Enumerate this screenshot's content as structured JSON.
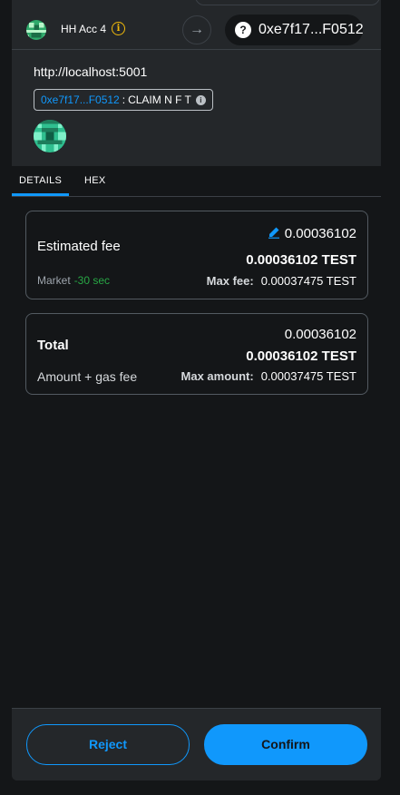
{
  "header": {
    "account_name": "HH Acc 4",
    "info_glyph": "i",
    "arrow_glyph": "→",
    "recipient_glyph": "?",
    "recipient_address": "0xe7f17...F0512"
  },
  "site": {
    "origin": "http://localhost:5001",
    "method_address": "0xe7f17...F0512",
    "method_separator": ":",
    "method_name": "CLAIM N F T",
    "method_info_glyph": "i"
  },
  "tabs": [
    "DETAILS",
    "HEX"
  ],
  "active_tab": "DETAILS",
  "fee_card": {
    "label": "Estimated fee",
    "primary_value": "0.00036102",
    "secondary_value": "0.00036102 TEST",
    "market_label": "Market",
    "market_time": "-30 sec",
    "max_fee_label": "Max fee:",
    "max_fee_value": "0.00037475 TEST"
  },
  "total_card": {
    "label": "Total",
    "primary_value": "0.00036102",
    "secondary_value": "0.00036102 TEST",
    "sub_label": "Amount + gas fee",
    "max_amount_label": "Max amount:",
    "max_amount_value": "0.00037475 TEST"
  },
  "footer": {
    "reject_label": "Reject",
    "confirm_label": "Confirm"
  },
  "colors": {
    "accent": "#1098fc",
    "market_time": "#28a745",
    "warning": "#f0b90b",
    "background": "#141618",
    "panel": "#24272a"
  },
  "icons": {
    "avatar": "identicon",
    "info": "info-icon",
    "arrow": "arrow-right-icon",
    "unknown_recipient": "question-icon",
    "edit": "edit-pencil-icon"
  }
}
